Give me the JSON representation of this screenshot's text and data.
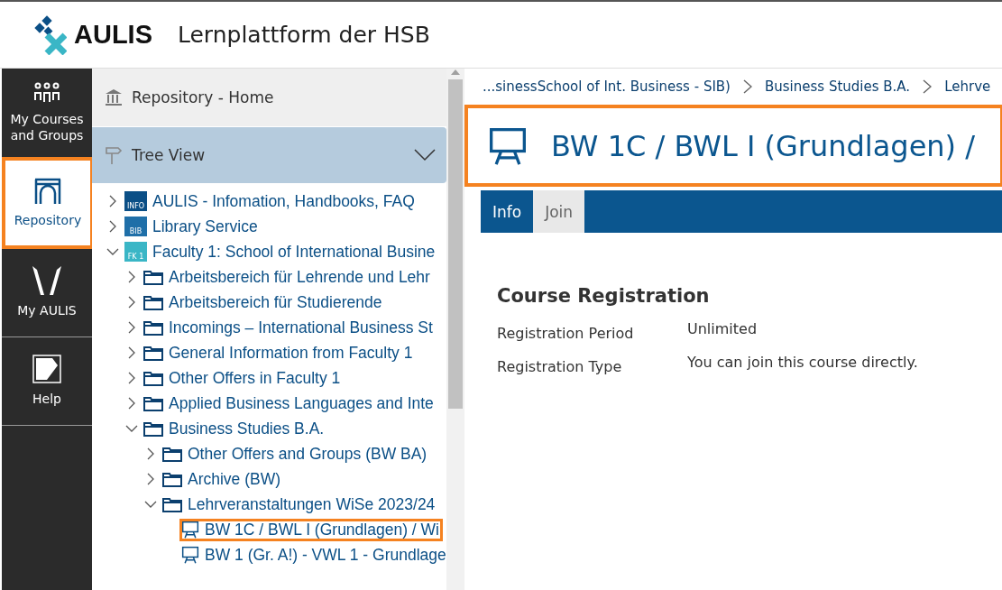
{
  "header": {
    "logo_text": "AULIS",
    "title": "Lernplattform der HSB"
  },
  "nav": [
    {
      "kind": "courses",
      "label": "My Courses and Groups",
      "selected": false
    },
    {
      "kind": "repository",
      "label": "Repository",
      "selected": true
    },
    {
      "kind": "personal",
      "label": "My AULIS",
      "selected": false
    },
    {
      "kind": "help",
      "label": "Help",
      "selected": false
    }
  ],
  "tree_panel": {
    "home": "Repository - Home",
    "view": "Tree View",
    "items": [
      {
        "kind": "badge",
        "badge": "INFO",
        "color": "#0b4f86",
        "label": "AULIS - Infomation, Handbooks, FAQ",
        "expanded": false,
        "highlighted": false
      },
      {
        "kind": "badge",
        "badge": "BIB",
        "color": "#1f6fa8",
        "label": "Library Service",
        "expanded": false,
        "highlighted": false
      },
      {
        "kind": "badge",
        "badge": "FK 1",
        "color": "#3ab6c6",
        "label": "Faculty 1: School of International Busine",
        "expanded": true,
        "highlighted": false,
        "children": [
          {
            "kind": "folder",
            "label": "Arbeitsbereich für Lehrende und Lehr",
            "expanded": false,
            "highlighted": false
          },
          {
            "kind": "folder",
            "label": "Arbeitsbereich für Studierende",
            "expanded": false,
            "highlighted": false
          },
          {
            "kind": "folder",
            "label": "Incomings – International Business St",
            "expanded": false,
            "highlighted": false
          },
          {
            "kind": "folder",
            "label": "General Information from Faculty 1",
            "expanded": false,
            "highlighted": false
          },
          {
            "kind": "folder",
            "label": "Other Offers in Faculty 1",
            "expanded": false,
            "highlighted": false
          },
          {
            "kind": "folder",
            "label": "Applied Business Languages and Inte",
            "expanded": false,
            "highlighted": false
          },
          {
            "kind": "folder",
            "label": "Business Studies B.A.",
            "expanded": true,
            "highlighted": false,
            "children": [
              {
                "kind": "folder",
                "label": "Other Offers and Groups (BW BA)",
                "expanded": false,
                "highlighted": false
              },
              {
                "kind": "folder",
                "label": "Archive (BW)",
                "expanded": false,
                "highlighted": false
              },
              {
                "kind": "folder",
                "label": "Lehrveranstaltungen WiSe 2023/24",
                "expanded": true,
                "highlighted": false,
                "children": [
                  {
                    "kind": "course",
                    "label": "BW 1C / BWL I (Grundlagen) / Wi",
                    "highlighted": true
                  },
                  {
                    "kind": "course",
                    "label": "BW 1 (Gr. A!) - VWL 1 - Grundlage",
                    "highlighted": false
                  }
                ]
              }
            ]
          }
        ]
      }
    ]
  },
  "breadcrumbs": [
    "...sinessSchool of Int. Business - SIB)",
    "Business Studies B.A.",
    "Lehrve"
  ],
  "page_title": {
    "text": "BW 1C / BWL I (Grundlagen) /",
    "highlighted": true
  },
  "tabs": [
    {
      "label": "Info",
      "selected": true
    },
    {
      "label": "Join",
      "selected": false
    }
  ],
  "registration": {
    "heading": "Course Registration",
    "rows": [
      {
        "label": "Registration Period",
        "value": "Unlimited"
      },
      {
        "label": "Registration Type",
        "value": "You can join this course directly."
      }
    ]
  }
}
